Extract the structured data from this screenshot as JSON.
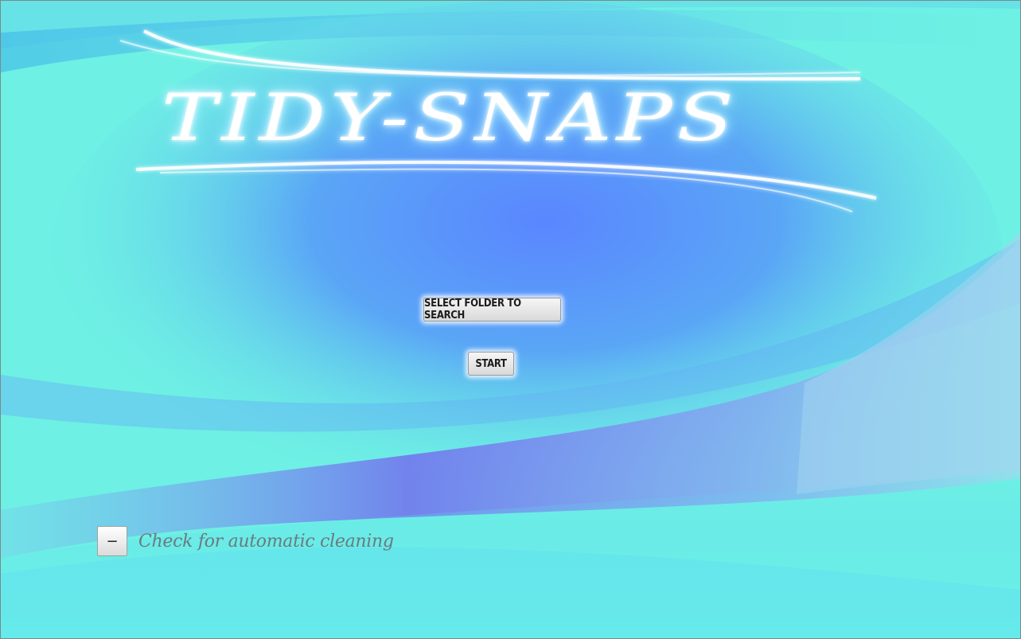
{
  "app": {
    "logo_text": "TIDY-SNAPS"
  },
  "buttons": {
    "select_folder_label": "SELECT FOLDER TO SEARCH",
    "start_label": "START"
  },
  "auto_clean": {
    "checkbox_glyph": "−",
    "label": "Check for automatic cleaning"
  },
  "colors": {
    "background_light": "#6ef0e4",
    "background_center": "#5a8cff",
    "wave_purple": "#7a6ef0",
    "label_text": "#6a7a80"
  }
}
